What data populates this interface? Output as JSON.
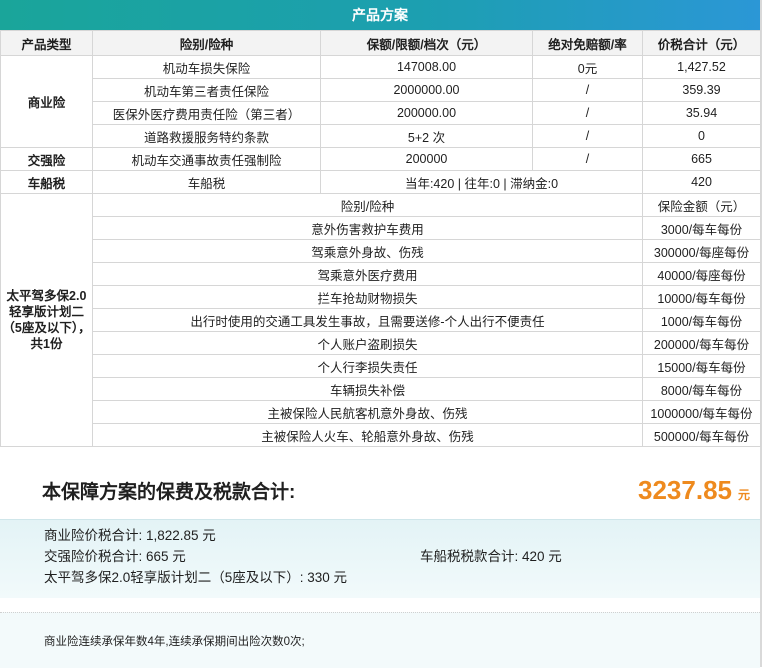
{
  "header": {
    "title": "产品方案"
  },
  "table": {
    "columns": [
      "产品类型",
      "险别/险种",
      "保额/限额/档次（元）",
      "绝对免赔额/率",
      "价税合计（元）"
    ],
    "commercial": {
      "type": "商业险",
      "rows": [
        {
          "name": "机动车损失保险",
          "amount": "147008.00",
          "deductible": "0元",
          "total": "1,427.52"
        },
        {
          "name": "机动车第三者责任保险",
          "amount": "2000000.00",
          "deductible": "/",
          "total": "359.39"
        },
        {
          "name": "医保外医疗费用责任险（第三者）",
          "amount": "200000.00",
          "deductible": "/",
          "total": "35.94"
        },
        {
          "name": "道路救援服务特约条款",
          "amount": "5+2 次",
          "deductible": "/",
          "total": "0"
        }
      ]
    },
    "compulsory": {
      "type": "交强险",
      "name": "机动车交通事故责任强制险",
      "amount": "200000",
      "deductible": "/",
      "total": "665"
    },
    "vessel_tax": {
      "type": "车船税",
      "name": "车船税",
      "amount": "当年:420 | 往年:0 | 滞纳金:0",
      "total": "420"
    },
    "plan": {
      "type": "太平驾多保2.0轻享版计划二（5座及以下），共1份",
      "sub_columns": [
        "险别/险种",
        "保险金额（元）"
      ],
      "rows": [
        {
          "name": "意外伤害救护车费用",
          "amount": "3000/每车每份"
        },
        {
          "name": "驾乘意外身故、伤残",
          "amount": "300000/每座每份"
        },
        {
          "name": "驾乘意外医疗费用",
          "amount": "40000/每座每份"
        },
        {
          "name": "拦车抢劫财物损失",
          "amount": "10000/每车每份"
        },
        {
          "name": "出行时使用的交通工具发生事故，且需要送修-个人出行不便责任",
          "amount": "1000/每车每份"
        },
        {
          "name": "个人账户盗刷损失",
          "amount": "200000/每车每份"
        },
        {
          "name": "个人行李损失责任",
          "amount": "15000/每车每份"
        },
        {
          "name": "车辆损失补偿",
          "amount": "8000/每车每份"
        },
        {
          "name": "主被保险人民航客机意外身故、伤残",
          "amount": "1000000/每车每份"
        },
        {
          "name": "主被保险人火车、轮船意外身故、伤残",
          "amount": "500000/每车每份"
        }
      ]
    }
  },
  "total": {
    "label": "本保障方案的保费及税款合计:",
    "amount": "3237.85",
    "unit": "元"
  },
  "summary": {
    "commercial": "商业险价税合计: 1,822.85 元",
    "compulsory": "交强险价税合计: 665 元",
    "vessel_tax": "车船税税款合计: 420 元",
    "plan": "太平驾多保2.0轻享版计划二（5座及以下）: 330 元"
  },
  "footnote": "商业险连续承保年数4年,连续承保期间出险次数0次;",
  "colors": {
    "banner_start": "#1aa59a",
    "banner_end": "#2b97d6",
    "total_amount": "#ee8a1e"
  }
}
